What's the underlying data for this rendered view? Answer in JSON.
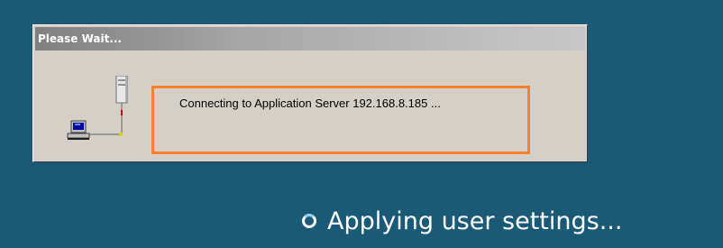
{
  "dialog": {
    "title": "Please Wait...",
    "message": "Connecting to Application Server 192.168.8.185 ...",
    "icon": "network-computer-server-icon"
  },
  "status": {
    "text": "Applying user settings...",
    "icon": "spinner-icon"
  },
  "colors": {
    "desktop_background": "#1a5a76",
    "dialog_face": "#d4d0c8",
    "highlight_border": "#ff7f2a",
    "status_text": "#ffffff"
  }
}
